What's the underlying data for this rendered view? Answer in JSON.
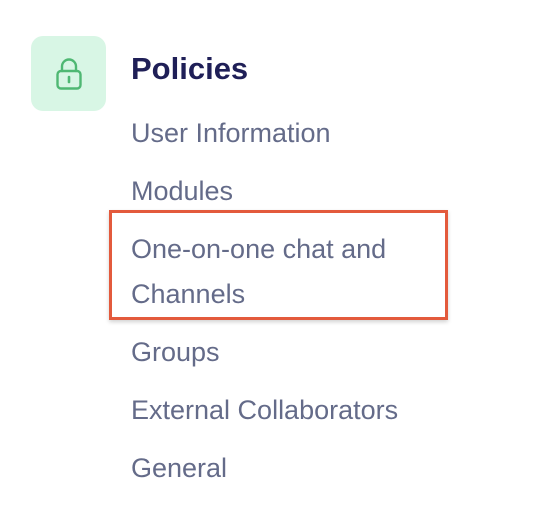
{
  "section": {
    "icon": "lock-icon",
    "title": "Policies",
    "accent_color": "#4fb873",
    "tile_color": "#d8f6e5",
    "title_color": "#1f1f57"
  },
  "menu": {
    "items": [
      {
        "label": "User Information"
      },
      {
        "label": "Modules"
      },
      {
        "label": "One-on-one chat and Channels",
        "highlighted": true
      },
      {
        "label": "Groups"
      },
      {
        "label": "External Collaborators"
      },
      {
        "label": "General"
      }
    ],
    "text_color": "#646b89",
    "highlight_color": "#e35a3c"
  }
}
